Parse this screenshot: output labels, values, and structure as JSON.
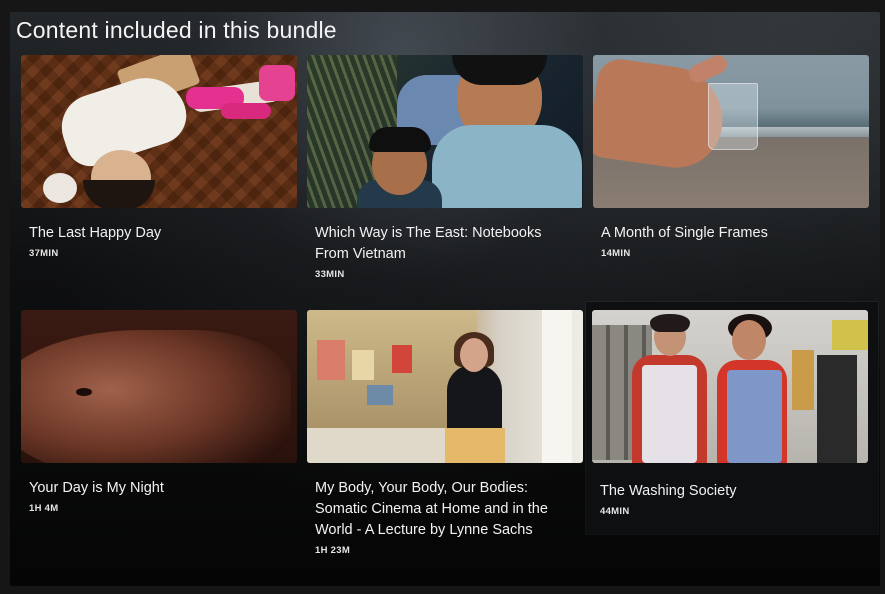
{
  "section": {
    "title": "Content included in this bundle"
  },
  "items": [
    {
      "title": "The Last Happy Day",
      "duration": "37MIN",
      "thumbnail": "girl-lying-on-parquet-floor"
    },
    {
      "title": "Which Way is The East: Notebooks From Vietnam",
      "duration": "33MIN",
      "thumbnail": "children-in-vietnam"
    },
    {
      "title": "A Month of Single Frames",
      "duration": "14MIN",
      "thumbnail": "hand-holding-glass-by-sea"
    },
    {
      "title": "Your Day is My Night",
      "duration": "1H 4M",
      "thumbnail": "closeup-face-red-light"
    },
    {
      "title": "My Body, Your Body, Our Bodies: Somatic Cinema at Home and in the World - A Lecture by Lynne Sachs",
      "duration": "1H 23M",
      "thumbnail": "woman-speaking-in-home-office"
    },
    {
      "title": "The Washing Society",
      "duration": "44MIN",
      "thumbnail": "women-in-laundromat"
    }
  ],
  "hovered_item_index": 5
}
